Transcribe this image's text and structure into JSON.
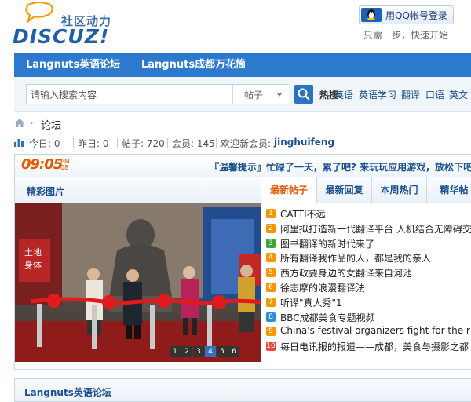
{
  "header": {
    "slogan": "社区动力",
    "logo_text": "DISCUZ!",
    "qq_login_label": "用QQ帐号登录",
    "qq_tip": "只需一步，快速开始"
  },
  "nav": {
    "items": [
      {
        "label": "Langnuts英语论坛"
      },
      {
        "label": "Langnuts成都万花筒"
      }
    ]
  },
  "search": {
    "placeholder": "请输入搜索内容",
    "type_value": "帖子",
    "hot_label": "热搜:",
    "hot_words": [
      "英语",
      "英语学习",
      "翻译",
      "口语",
      "英文"
    ]
  },
  "breadcrumb": {
    "label": "论坛"
  },
  "stats": {
    "today": "今日: 0",
    "yesterday": "昨日: 0",
    "posts": "帖子: 720",
    "members": "会员: 145",
    "welcome": "欢迎新会员:",
    "new_member": "jinghuifeng"
  },
  "info_bar": {
    "time": "09:05",
    "time_suffix_1": "PM",
    "time_suffix_2": "08",
    "tip": "『温馨提示』忙碌了一天，累了吧? 来玩玩应用游戏，放松下吧!"
  },
  "left_panel": {
    "title": "精彩图片",
    "slide_numbers": [
      "1",
      "2",
      "3",
      "4",
      "5",
      "6"
    ],
    "active_slide": 4
  },
  "tabs": [
    {
      "label": "最新帖子",
      "active": true
    },
    {
      "label": "最新回复",
      "active": false
    },
    {
      "label": "本周热门",
      "active": false
    },
    {
      "label": "精华帖",
      "active": false
    }
  ],
  "threads": [
    {
      "rank": "1",
      "title": "CATTI不远",
      "color": "#f39800"
    },
    {
      "rank": "2",
      "title": "阿里拟打造新一代翻译平台 人机结合无障碍交流",
      "color": "#f39800"
    },
    {
      "rank": "3",
      "title": "图书翻译的新时代来了",
      "color": "#3ea534"
    },
    {
      "rank": "4",
      "title": "所有翻译我作品的人，都是我的亲人",
      "color": "#f39800"
    },
    {
      "rank": "5",
      "title": "西方政要身边的女翻译来自河池",
      "color": "#f39800"
    },
    {
      "rank": "6",
      "title": "徐志摩的浪漫翻译法",
      "color": "#f39800"
    },
    {
      "rank": "7",
      "title": "听译\"真人秀\"1",
      "color": "#f39800"
    },
    {
      "rank": "8",
      "title": "BBC成都美食专题视频",
      "color": "#2b8fd6"
    },
    {
      "rank": "9",
      "title": "China's festival organizers fight for the right to party",
      "color": "#f39800"
    },
    {
      "rank": "10",
      "title": "每日电讯报的报道——成都，美食与摄影之都",
      "color": "#e8483a"
    }
  ],
  "forum": {
    "title": "Langnuts英语论坛"
  }
}
